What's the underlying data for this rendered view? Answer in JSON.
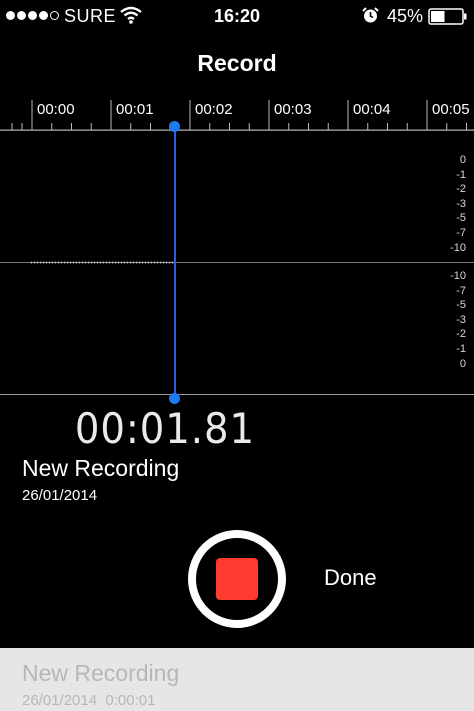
{
  "status_bar": {
    "carrier": "SURE",
    "time": "16:20",
    "battery_percent": "45%",
    "battery_level": 0.45,
    "signal_dots_filled": 4,
    "signal_dots_total": 5,
    "icons": [
      "wifi-icon",
      "alarm-icon",
      "battery-icon"
    ]
  },
  "header": {
    "title": "Record"
  },
  "ruler": {
    "labels": [
      "00:00",
      "00:01",
      "00:02",
      "00:03",
      "00:04",
      "00:05"
    ]
  },
  "level_scale": {
    "upper": [
      "0",
      "-1",
      "-2",
      "-3",
      "-5",
      "-7",
      "-10"
    ],
    "lower": [
      "-10",
      "-7",
      "-5",
      "-3",
      "-2",
      "-1",
      "0"
    ]
  },
  "recording": {
    "elapsed": "00:01.81",
    "name": "New Recording",
    "date": "26/01/2014"
  },
  "controls": {
    "done_label": "Done",
    "stop_color": "#ff3b30",
    "playhead_color": "#1e7cf2"
  },
  "list": [
    {
      "name": "New Recording",
      "date": "26/01/2014",
      "duration": "0:00:01"
    }
  ]
}
